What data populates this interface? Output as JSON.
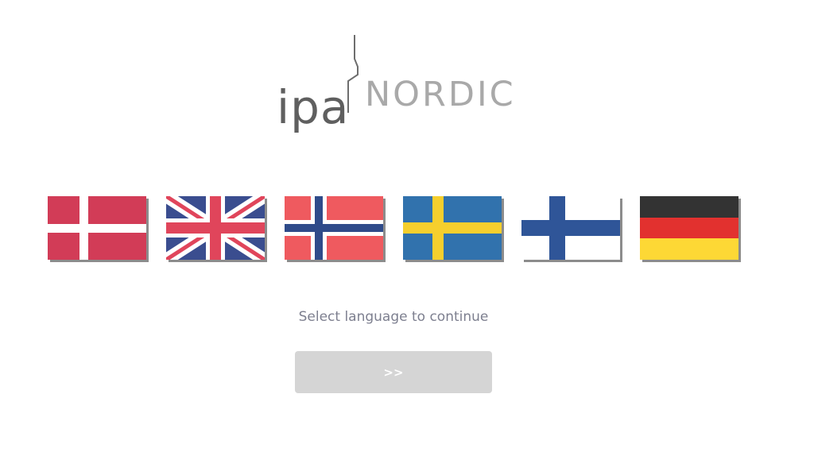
{
  "logo": {
    "ipa": "ipa",
    "nordic": "NORDIC"
  },
  "flags": [
    {
      "country": "Denmark"
    },
    {
      "country": "United Kingdom"
    },
    {
      "country": "Norway"
    },
    {
      "country": "Sweden"
    },
    {
      "country": "Finland"
    },
    {
      "country": "Germany"
    }
  ],
  "prompt": "Select language to continue",
  "continue_button": {
    "label": ">>",
    "enabled": false
  },
  "colors": {
    "logo_dark": "#5f5f5f",
    "logo_light": "#a9a9a9",
    "prompt_text": "#7d7f8f",
    "button_disabled_bg": "#d5d5d5"
  }
}
